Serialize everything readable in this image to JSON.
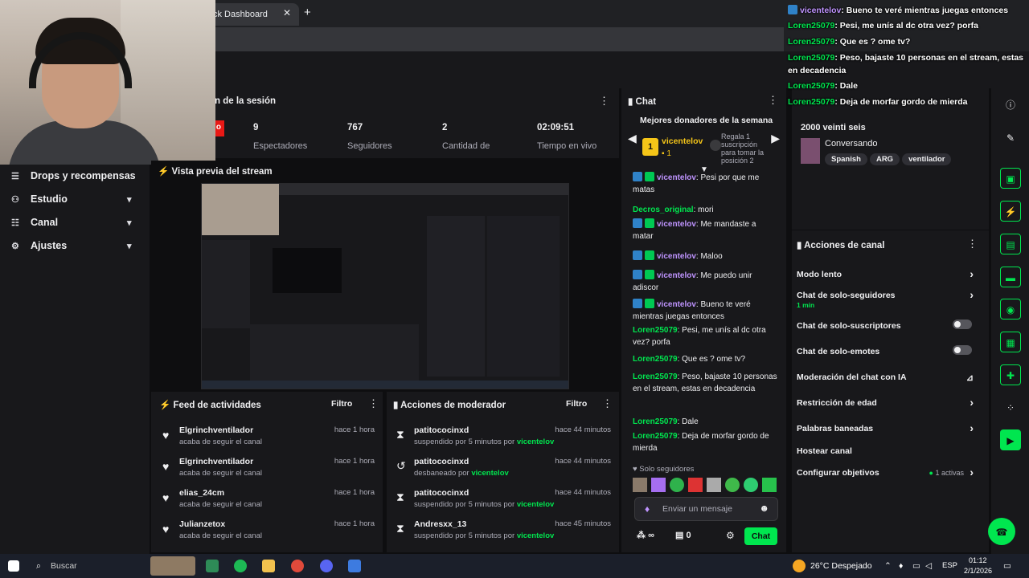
{
  "browser": {
    "tab_title": "ck Dashboard",
    "tab_close": "✕",
    "tab_new": "+"
  },
  "sidebar": {
    "items": [
      {
        "label": "Drops y recompensas",
        "icon": "gift-icon"
      },
      {
        "label": "Estudio",
        "icon": "studio-icon"
      },
      {
        "label": "Canal",
        "icon": "channel-icon"
      },
      {
        "label": "Ajustes",
        "icon": "gear-icon"
      }
    ]
  },
  "session": {
    "title": "n de la sesión",
    "live_badge": "o",
    "stats": [
      {
        "value": "9",
        "label": "Espectadores"
      },
      {
        "value": "767",
        "label": "Seguidores"
      },
      {
        "value": "2",
        "label": "Cantidad de"
      },
      {
        "value": "02:09:51",
        "label": "Tiempo en vivo"
      }
    ]
  },
  "preview": {
    "title": "Vista previa del stream"
  },
  "feed": {
    "title": "Feed de actividades",
    "filter": "Filtro",
    "rows": [
      {
        "name": "Elgrinchventilador",
        "sub": "acaba de seguir el canal",
        "time": "hace 1 hora"
      },
      {
        "name": "Elgrinchventilador",
        "sub": "acaba de seguir el canal",
        "time": "hace 1 hora"
      },
      {
        "name": "elias_24cm",
        "sub": "acaba de seguir el canal",
        "time": "hace 1 hora"
      },
      {
        "name": "Julianzetox",
        "sub": "acaba de seguir el canal",
        "time": "hace 1 hora"
      }
    ]
  },
  "moderator": {
    "title": "Acciones de moderador",
    "filter": "Filtro",
    "rows": [
      {
        "icon": "hourglass-icon",
        "glyph": "⧗",
        "name": "patitococinxd",
        "sub": "suspendido por 5 minutos por ",
        "by": "vicentelov",
        "time": "hace 44 minutos"
      },
      {
        "icon": "undo-icon",
        "glyph": "↺",
        "name": "patitococinxd",
        "sub": "desbaneado por ",
        "by": "vicentelov",
        "time": "hace 44 minutos"
      },
      {
        "icon": "hourglass-icon",
        "glyph": "⧗",
        "name": "patitococinxd",
        "sub": "suspendido por 5 minutos por ",
        "by": "vicentelov",
        "time": "hace 44 minutos"
      },
      {
        "icon": "hourglass-icon",
        "glyph": "⧗",
        "name": "Andresxx_13",
        "sub": "suspendido por 5 minutos por ",
        "by": "vicentelov",
        "time": "hace 45 minutos"
      }
    ]
  },
  "chat": {
    "title": "Chat",
    "donors_title": "Mejores donadores de la semana",
    "donor_name": "vicentelov",
    "donor_rank": "1",
    "donor_count": "1",
    "gift_prompt": "Regala 1 suscripción para tomar la posición 2",
    "messages": [
      {
        "user": "vicentelov",
        "text": ": Pesi por que me matas",
        "badges": true,
        "vip": true
      },
      {
        "user": "Decros_original",
        "text": ": mori",
        "badges": false,
        "vip": false
      },
      {
        "user": "vicentelov",
        "text": ": Me mandaste a matar",
        "badges": true,
        "vip": true
      },
      {
        "user": "vicentelov",
        "text": ": Maloo",
        "badges": true,
        "vip": true
      },
      {
        "user": "vicentelov",
        "text": ": Me puedo unir adiscor",
        "badges": true,
        "vip": true
      },
      {
        "user": "vicentelov",
        "text": ": Bueno te veré mientras juegas entonces",
        "badges": true,
        "vip": true
      },
      {
        "user": "Loren25079",
        "text": ": Pesi, me unís al dc otra vez? porfa",
        "badges": false,
        "vip": false
      },
      {
        "user": "Loren25079",
        "text": ": Que es ? ome tv?",
        "badges": false,
        "vip": false
      },
      {
        "user": "Loren25079",
        "text": ": Peso, bajaste 10 personas en el stream, estas en decadencia",
        "badges": false,
        "vip": false
      },
      {
        "user": "Loren25079",
        "text": ": Dale",
        "badges": false,
        "vip": false
      },
      {
        "user": "Loren25079",
        "text": ": Deja de morfar gordo de mierda",
        "badges": false,
        "vip": false
      }
    ],
    "mode_label": "Solo seguidores",
    "input_placeholder": "Enviar un mensaje",
    "points": "∞",
    "store_count": "0",
    "send_label": "Chat"
  },
  "stream_info": {
    "title": "2000 veinti seis",
    "category": "Conversando",
    "tags": [
      "Spanish",
      "ARG",
      "ventilador"
    ]
  },
  "channel_actions": {
    "title": "Acciones de canal",
    "items": [
      {
        "label": "Modo lento",
        "control": "chevron",
        "sub": ""
      },
      {
        "label": "Chat de solo-seguidores",
        "control": "chevron",
        "sub": "1 min"
      },
      {
        "label": "Chat de solo-suscriptores",
        "control": "toggle",
        "sub": ""
      },
      {
        "label": "Chat de solo-emotes",
        "control": "toggle",
        "sub": ""
      },
      {
        "label": "Moderación del chat con IA",
        "control": "chart",
        "sub": ""
      },
      {
        "label": "Restricción de edad",
        "control": "chevron",
        "sub": ""
      },
      {
        "label": "Palabras baneadas",
        "control": "chevron",
        "sub": ""
      },
      {
        "label": "Hostear canal",
        "control": "none",
        "sub": ""
      },
      {
        "label": "Configurar objetivos",
        "control": "chevron",
        "sub": "",
        "extra": "1 activas"
      }
    ]
  },
  "overlay": {
    "lines": [
      {
        "user": "vicentelov",
        "text": ": Bueno te veré mientras juegas entonces",
        "vip": true
      },
      {
        "user": "Loren25079",
        "text": ": Pesi, me unís al dc otra vez? porfa",
        "vip": false
      },
      {
        "user": "Loren25079",
        "text": ": Que es ? ome tv?",
        "vip": false
      },
      {
        "user": "Loren25079",
        "text": ": Peso, bajaste 10 personas en el stream, estas",
        "vip": false
      },
      {
        "user": "",
        "text": "en decadencia",
        "vip": false
      },
      {
        "user": "Loren25079",
        "text": ": Dale",
        "vip": false
      },
      {
        "user": "Loren25079",
        "text": ": Deja de morfar gordo de mierda",
        "vip": false
      }
    ]
  },
  "taskbar": {
    "search": "Buscar",
    "weather": "26°C  Despejado",
    "lang": "ESP",
    "time": "01:12",
    "date": "2/1/2026"
  },
  "colors": {
    "accent": "#00e64f",
    "vip": "#bf94ff",
    "live": "#e91916"
  }
}
